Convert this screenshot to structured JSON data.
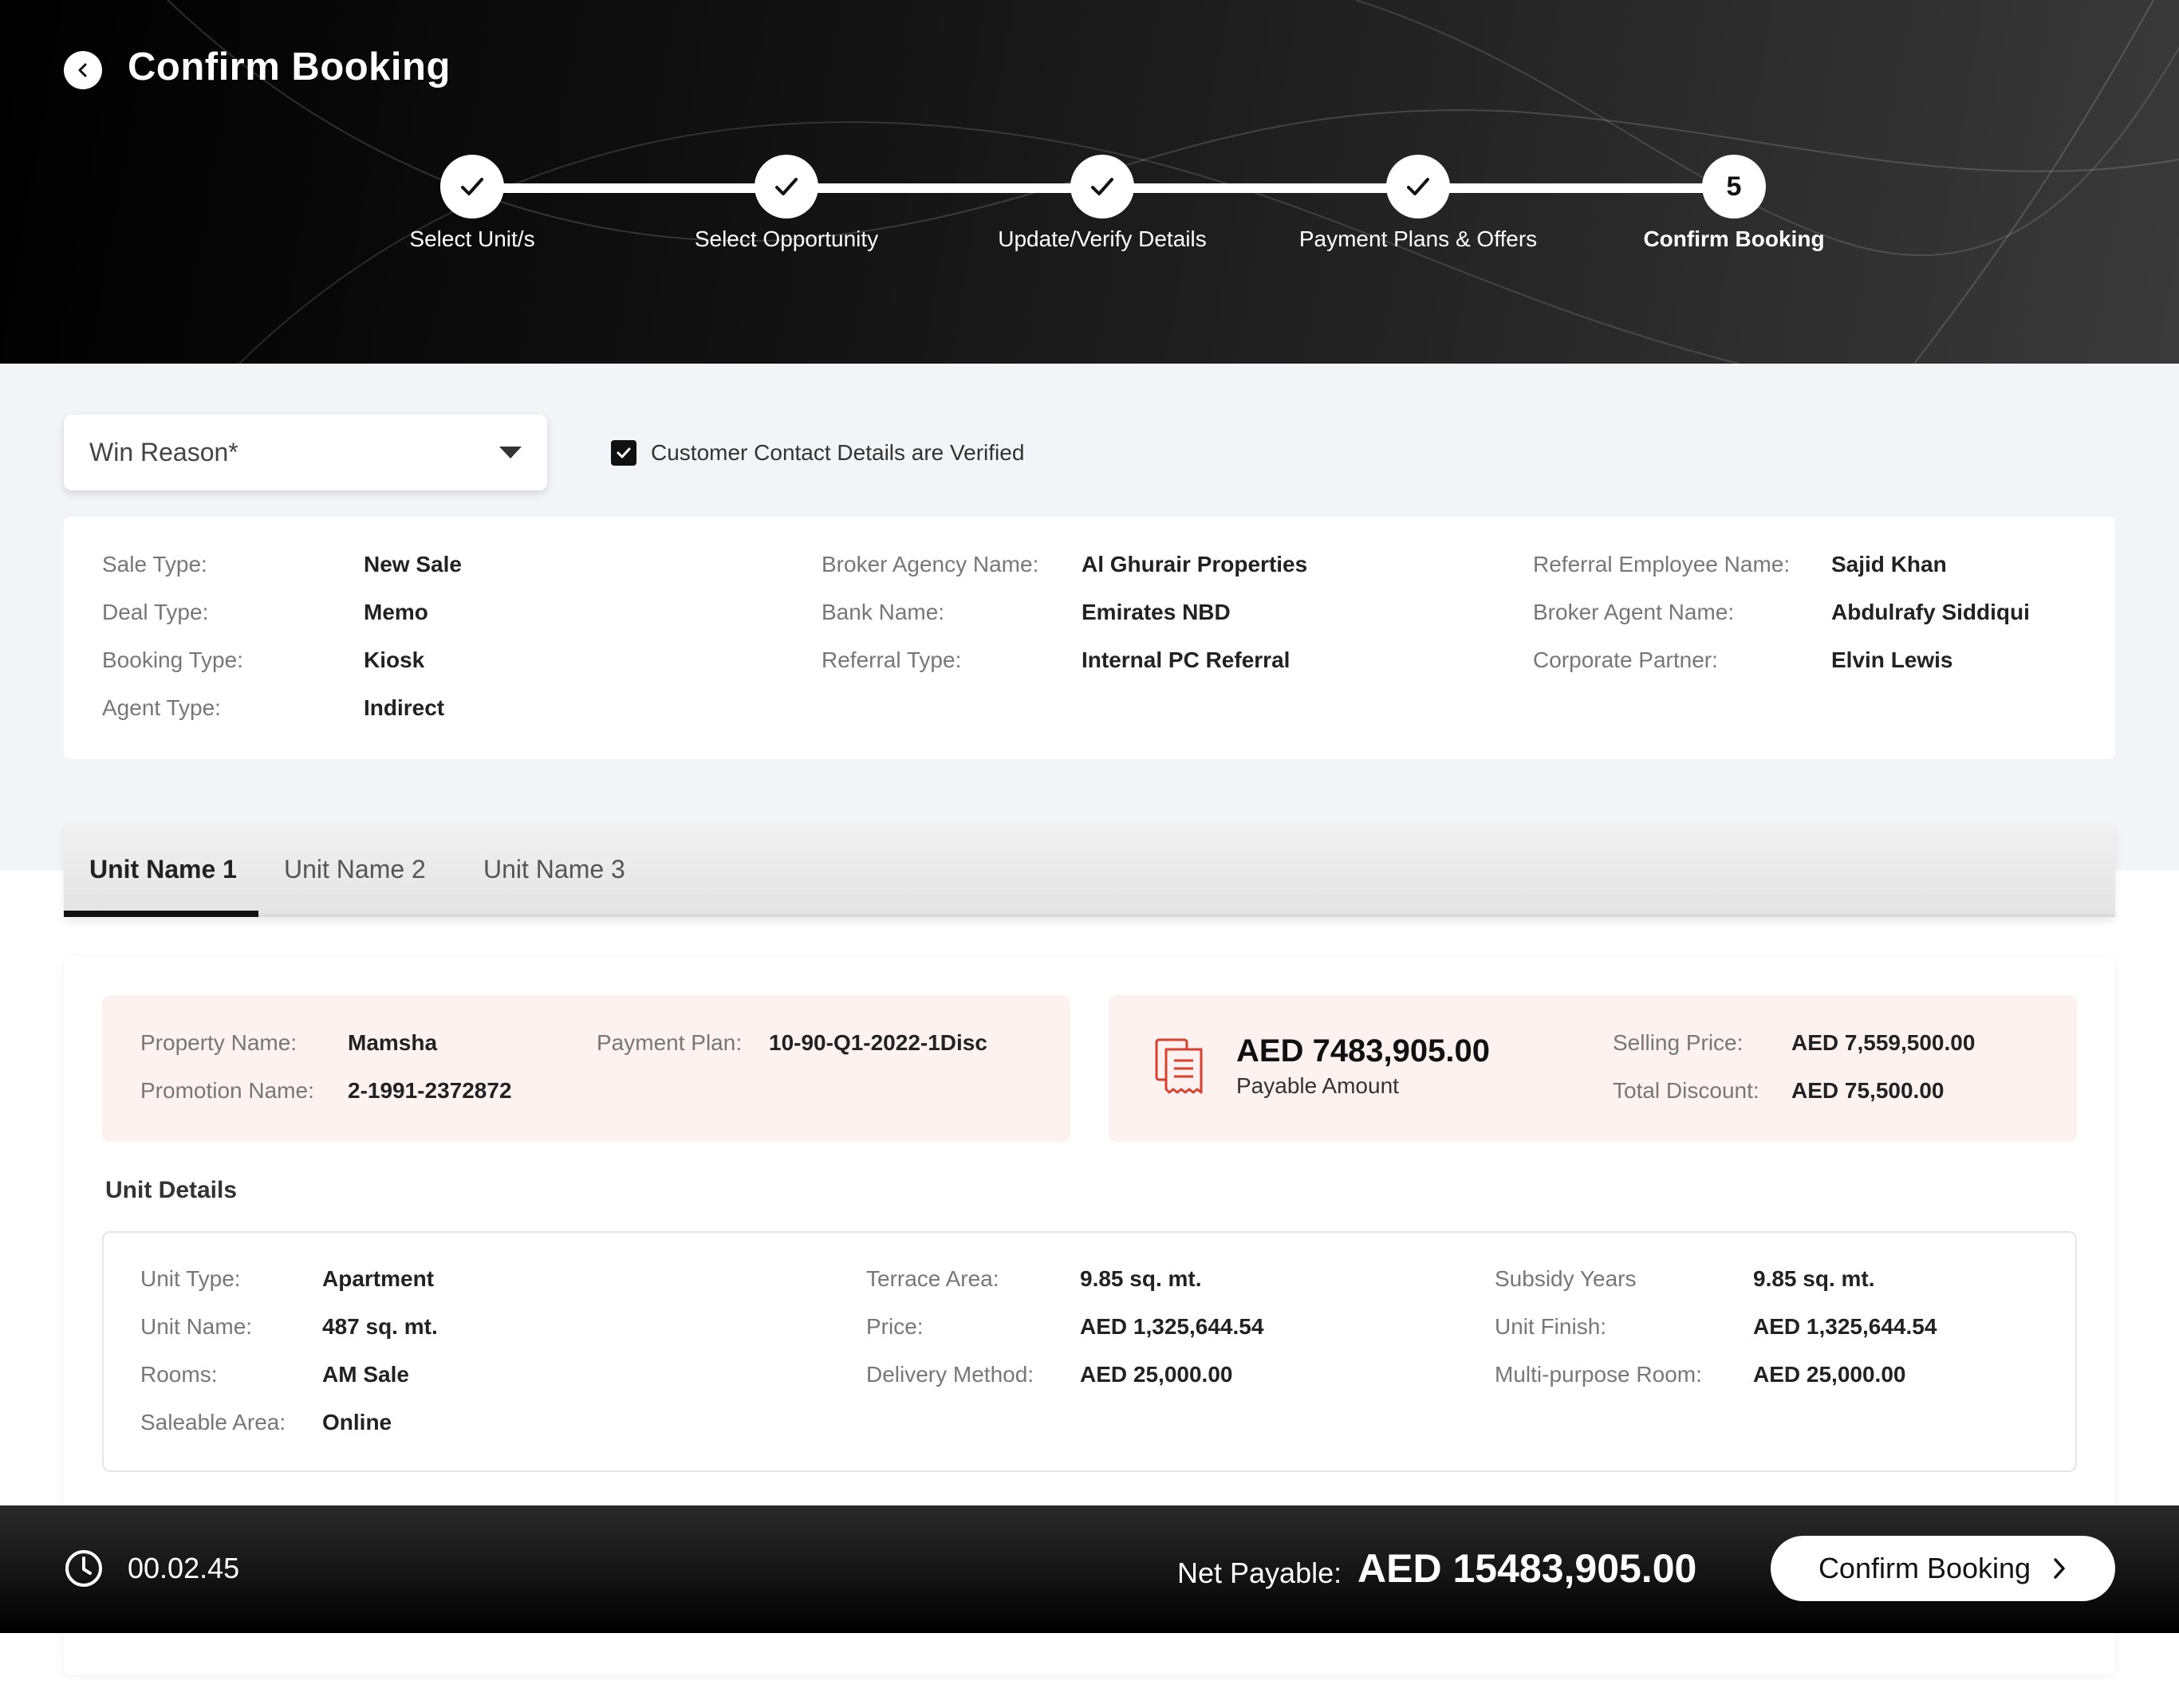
{
  "header": {
    "title": "Confirm Booking",
    "steps": [
      {
        "label": "Select Unit/s",
        "state": "done"
      },
      {
        "label": "Select Opportunity",
        "state": "done"
      },
      {
        "label": "Update/Verify Details",
        "state": "done"
      },
      {
        "label": "Payment Plans & Offers",
        "state": "done"
      },
      {
        "label": "Confirm Booking",
        "state": "active",
        "number": "5"
      }
    ]
  },
  "form": {
    "win_reason_label": "Win Reason*",
    "verified_label": "Customer Contact Details are Verified",
    "verified_checked": true
  },
  "booking_info": {
    "col1": [
      {
        "label": "Sale Type:",
        "value": "New Sale"
      },
      {
        "label": "Deal Type:",
        "value": "Memo"
      },
      {
        "label": "Booking Type:",
        "value": "Kiosk"
      },
      {
        "label": "Agent Type:",
        "value": "Indirect"
      }
    ],
    "col2": [
      {
        "label": "Broker Agency Name:",
        "value": "Al Ghurair Properties"
      },
      {
        "label": "Bank Name:",
        "value": "Emirates NBD"
      },
      {
        "label": "Referral Type:",
        "value": "Internal PC Referral"
      }
    ],
    "col3": [
      {
        "label": "Referral Employee Name:",
        "value": "Sajid Khan"
      },
      {
        "label": "Broker Agent Name:",
        "value": "Abdulrafy Siddiqui"
      },
      {
        "label": "Corporate Partner:",
        "value": "Elvin Lewis"
      }
    ]
  },
  "tabs": [
    {
      "label": "Unit Name 1",
      "active": true
    },
    {
      "label": "Unit Name 2",
      "active": false
    },
    {
      "label": "Unit Name 3",
      "active": false
    }
  ],
  "unit": {
    "property": {
      "property_name_label": "Property Name:",
      "property_name": "Mamsha",
      "payment_plan_label": "Payment Plan:",
      "payment_plan": "10-90-Q1-2022-1Disc",
      "promotion_name_label": "Promotion Name:",
      "promotion_name": "2-1991-2372872"
    },
    "payment": {
      "payable_amount": "AED 7483,905.00",
      "payable_label": "Payable Amount",
      "selling_price_label": "Selling Price:",
      "selling_price": "AED 7,559,500.00",
      "total_discount_label": "Total Discount:",
      "total_discount": "AED 75,500.00",
      "icon": "receipt-icon"
    },
    "details_title": "Unit Details",
    "details": {
      "col1": [
        {
          "label": "Unit Type:",
          "value": "Apartment"
        },
        {
          "label": "Unit Name:",
          "value": "487 sq. mt."
        },
        {
          "label": "Rooms:",
          "value": "AM Sale"
        },
        {
          "label": "Saleable Area:",
          "value": "Online"
        }
      ],
      "col2": [
        {
          "label": "Terrace Area:",
          "value": "9.85 sq. mt."
        },
        {
          "label": "Price:",
          "value": "AED 1,325,644.54"
        },
        {
          "label": "Delivery Method:",
          "value": "AED 25,000.00"
        }
      ],
      "col3": [
        {
          "label": "Subsidy Years",
          "value": "9.85 sq. mt."
        },
        {
          "label": "Unit Finish:",
          "value": "AED 1,325,644.54"
        },
        {
          "label": "Multi-purpose Room:",
          "value": "AED 25,000.00"
        }
      ]
    }
  },
  "footer": {
    "timer": "00.02.45",
    "net_payable_label": "Net Payable:",
    "net_payable_value": "AED 15483,905.00",
    "confirm_label": "Confirm Booking"
  },
  "colors": {
    "accent_red": "#d9412e",
    "pink_bg": "#fdf2f0",
    "page_grey": "#f3f4f8"
  }
}
